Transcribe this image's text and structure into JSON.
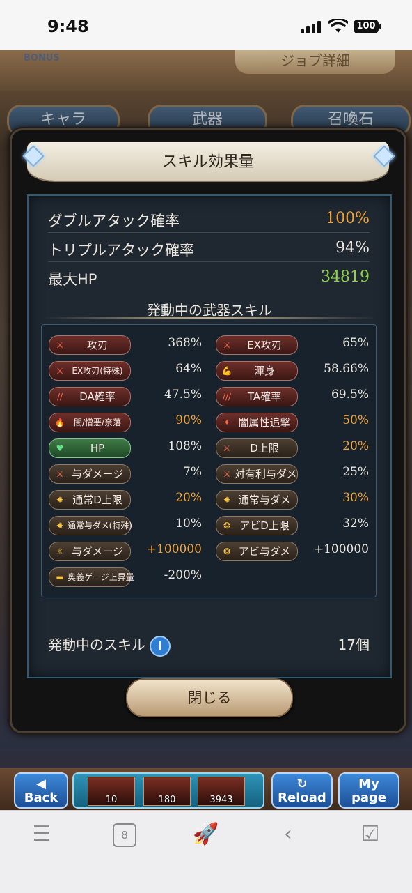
{
  "status_bar": {
    "time": "9:48",
    "battery": "100"
  },
  "background": {
    "bonus_label": "BONUS",
    "job_detail": "ジョブ詳細",
    "tabs": [
      "キャラ",
      "武器",
      "召喚石"
    ]
  },
  "modal": {
    "title": "スキル効果量",
    "stats": [
      {
        "label": "ダブルアタック確率",
        "value": "100%",
        "color": "#f2a43a"
      },
      {
        "label": "トリプルアタック確率",
        "value": "94%",
        "color": "#ece7df"
      },
      {
        "label": "最大HP",
        "value": "34819",
        "color": "#8ed14a"
      }
    ],
    "section_title": "発動中の武器スキル",
    "skills_left": [
      {
        "name": "攻刃",
        "value": "368%",
        "style": "red",
        "icon": "sword-icon",
        "color": "#ece7df"
      },
      {
        "name": "EX攻刃(特殊)",
        "value": "64%",
        "style": "red",
        "icon": "sword-icon",
        "color": "#ece7df"
      },
      {
        "name": "DA確率",
        "value": "47.5%",
        "style": "red",
        "icon": "double-slash-icon",
        "color": "#ece7df"
      },
      {
        "name": "闇/憎悪/奈落",
        "value": "90%",
        "style": "red",
        "icon": "flame-icon",
        "color": "#f2a43a"
      },
      {
        "name": "HP",
        "value": "108%",
        "style": "green",
        "icon": "heart-icon",
        "color": "#ece7df"
      },
      {
        "name": "与ダメージ",
        "value": "7%",
        "style": "gray",
        "icon": "sword-icon",
        "color": "#ece7df"
      },
      {
        "name": "通常D上限",
        "value": "20%",
        "style": "gray",
        "icon": "burst-icon",
        "color": "#f2a43a"
      },
      {
        "name": "通常与ダメ(特殊)",
        "value": "10%",
        "style": "gray",
        "icon": "burst-icon",
        "color": "#ece7df"
      },
      {
        "name": "与ダメージ",
        "value": "+100000",
        "style": "gray",
        "icon": "sun-icon",
        "color": "#f2a43a"
      },
      {
        "name": "奥義ゲージ上昇量",
        "value": "-200%",
        "style": "gray",
        "icon": "gauge-icon",
        "color": "#ece7df"
      }
    ],
    "skills_right": [
      {
        "name": "EX攻刃",
        "value": "65%",
        "style": "red",
        "icon": "sword-icon",
        "color": "#ece7df"
      },
      {
        "name": "渾身",
        "value": "58.66%",
        "style": "red",
        "icon": "muscle-icon",
        "color": "#ece7df"
      },
      {
        "name": "TA確率",
        "value": "69.5%",
        "style": "red",
        "icon": "triple-slash-icon",
        "color": "#ece7df"
      },
      {
        "name": "闇属性追撃",
        "value": "50%",
        "style": "red",
        "icon": "strike-icon",
        "color": "#f2a43a"
      },
      {
        "name": "D上限",
        "value": "20%",
        "style": "gray",
        "icon": "sword-icon",
        "color": "#f2a43a"
      },
      {
        "name": "対有利与ダメ",
        "value": "25%",
        "style": "gray",
        "icon": "sword-icon",
        "color": "#ece7df"
      },
      {
        "name": "通常与ダメ",
        "value": "30%",
        "style": "gray",
        "icon": "burst-icon",
        "color": "#f2a43a"
      },
      {
        "name": "アビD上限",
        "value": "32%",
        "style": "gray",
        "icon": "ability-icon",
        "color": "#ece7df"
      },
      {
        "name": "アビ与ダメ",
        "value": "+100000",
        "style": "gray",
        "icon": "ability-icon",
        "color": "#ece7df"
      }
    ],
    "active_skills_label": "発動中のスキル",
    "active_skills_count": "17個",
    "close_label": "閉じる"
  },
  "game_nav": {
    "back": "Back",
    "items": [
      "10",
      "180",
      "3943"
    ],
    "reload": "Reload",
    "mypage_line1": "My",
    "mypage_line2": "page"
  },
  "browser_toolbar": {
    "tab_count": "8"
  }
}
